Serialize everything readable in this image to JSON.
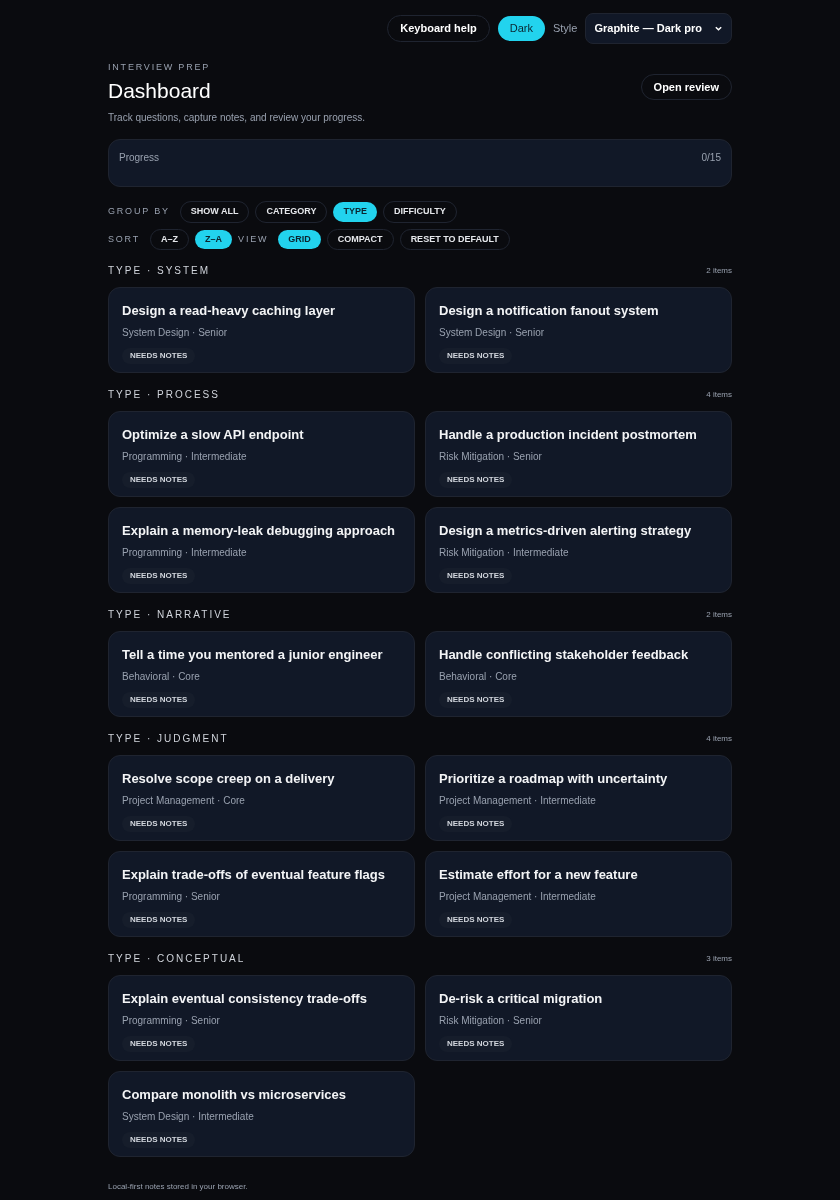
{
  "top_bar": {
    "keyboard_help": "Keyboard help",
    "theme_toggle": {
      "label": "Dark",
      "on": true
    },
    "style_label": "Style",
    "style_select": "Graphite — Dark pro"
  },
  "header": {
    "eyebrow": "INTERVIEW PREP",
    "title": "Dashboard",
    "subtitle": "Track questions, capture notes, and review your progress.",
    "open_review": "Open review"
  },
  "progress": {
    "label": "Progress",
    "count": "0/15"
  },
  "controls": [
    {
      "label": "GROUP BY",
      "chips": [
        {
          "label": "SHOW ALL",
          "selected": false
        },
        {
          "label": "CATEGORY",
          "selected": false
        },
        {
          "label": "TYPE",
          "selected": true
        },
        {
          "label": "DIFFICULTY",
          "selected": false
        }
      ]
    },
    {
      "label": "SORT",
      "chips": [
        {
          "label": "A–Z",
          "selected": false
        },
        {
          "label": "Z–A",
          "selected": true
        }
      ]
    },
    {
      "label": "VIEW",
      "chips": [
        {
          "label": "GRID",
          "selected": true
        },
        {
          "label": "COMPACT",
          "selected": false
        }
      ]
    }
  ],
  "reset": "RESET TO DEFAULT",
  "groups": [
    {
      "title": "TYPE · SYSTEM",
      "count": "2 items",
      "cards": [
        {
          "title": "Design a read-heavy caching layer",
          "meta": "System Design · Senior",
          "badge": "NEEDS NOTES"
        },
        {
          "title": "Design a notification fanout system",
          "meta": "System Design · Senior",
          "badge": "NEEDS NOTES"
        }
      ]
    },
    {
      "title": "TYPE · PROCESS",
      "count": "4 items",
      "cards": [
        {
          "title": "Optimize a slow API endpoint",
          "meta": "Programming · Intermediate",
          "badge": "NEEDS NOTES"
        },
        {
          "title": "Handle a production incident postmortem",
          "meta": "Risk Mitigation · Senior",
          "badge": "NEEDS NOTES"
        },
        {
          "title": "Explain a memory-leak debugging approach",
          "meta": "Programming · Intermediate",
          "badge": "NEEDS NOTES"
        },
        {
          "title": "Design a metrics-driven alerting strategy",
          "meta": "Risk Mitigation · Intermediate",
          "badge": "NEEDS NOTES"
        }
      ]
    },
    {
      "title": "TYPE · NARRATIVE",
      "count": "2 items",
      "cards": [
        {
          "title": "Tell a time you mentored a junior engineer",
          "meta": "Behavioral · Core",
          "badge": "NEEDS NOTES"
        },
        {
          "title": "Handle conflicting stakeholder feedback",
          "meta": "Behavioral · Core",
          "badge": "NEEDS NOTES"
        }
      ]
    },
    {
      "title": "TYPE · JUDGMENT",
      "count": "4 items",
      "cards": [
        {
          "title": "Resolve scope creep on a delivery",
          "meta": "Project Management · Core",
          "badge": "NEEDS NOTES"
        },
        {
          "title": "Prioritize a roadmap with uncertainty",
          "meta": "Project Management · Intermediate",
          "badge": "NEEDS NOTES"
        },
        {
          "title": "Explain trade-offs of eventual feature flags",
          "meta": "Programming · Senior",
          "badge": "NEEDS NOTES"
        },
        {
          "title": "Estimate effort for a new feature",
          "meta": "Project Management · Intermediate",
          "badge": "NEEDS NOTES"
        }
      ]
    },
    {
      "title": "TYPE · CONCEPTUAL",
      "count": "3 items",
      "cards": [
        {
          "title": "Explain eventual consistency trade-offs",
          "meta": "Programming · Senior",
          "badge": "NEEDS NOTES"
        },
        {
          "title": "De-risk a critical migration",
          "meta": "Risk Mitigation · Senior",
          "badge": "NEEDS NOTES"
        },
        {
          "title": "Compare monolith vs microservices",
          "meta": "System Design · Intermediate",
          "badge": "NEEDS NOTES"
        }
      ]
    }
  ],
  "footer": "Local-first notes stored in your browser."
}
